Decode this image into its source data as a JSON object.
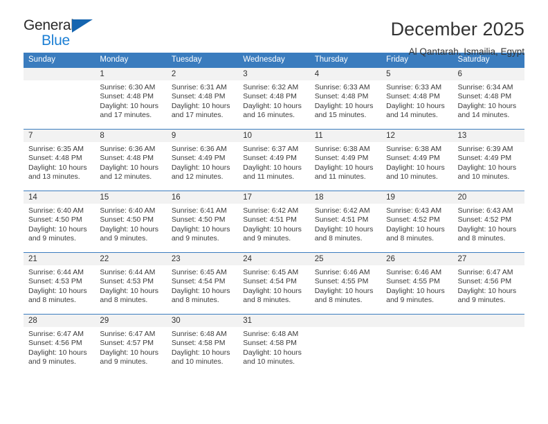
{
  "brand": {
    "name_primary": "General",
    "name_secondary": "Blue",
    "triangle_icon": "triangle-icon"
  },
  "header": {
    "title": "December 2025",
    "subtitle": "Al Qantarah, Ismailia, Egypt"
  },
  "colors": {
    "header_blue": "#3a7cbe",
    "logo_blue": "#1c7fd4",
    "logo_triangle": "#1565b0",
    "daynum_band": "#f2f2f2",
    "text": "#333333"
  },
  "weekday_headers": [
    "Sunday",
    "Monday",
    "Tuesday",
    "Wednesday",
    "Thursday",
    "Friday",
    "Saturday"
  ],
  "labels": {
    "sunrise_prefix": "Sunrise:",
    "sunset_prefix": "Sunset:",
    "daylight_prefix": "Daylight:"
  },
  "weeks": [
    [
      {
        "day": "",
        "blank": true,
        "sunrise": "",
        "sunset": "",
        "daylight_line1": "",
        "daylight_line2": ""
      },
      {
        "day": "1",
        "blank": false,
        "sunrise": "Sunrise: 6:30 AM",
        "sunset": "Sunset: 4:48 PM",
        "daylight_line1": "Daylight: 10 hours",
        "daylight_line2": "and 17 minutes."
      },
      {
        "day": "2",
        "blank": false,
        "sunrise": "Sunrise: 6:31 AM",
        "sunset": "Sunset: 4:48 PM",
        "daylight_line1": "Daylight: 10 hours",
        "daylight_line2": "and 17 minutes."
      },
      {
        "day": "3",
        "blank": false,
        "sunrise": "Sunrise: 6:32 AM",
        "sunset": "Sunset: 4:48 PM",
        "daylight_line1": "Daylight: 10 hours",
        "daylight_line2": "and 16 minutes."
      },
      {
        "day": "4",
        "blank": false,
        "sunrise": "Sunrise: 6:33 AM",
        "sunset": "Sunset: 4:48 PM",
        "daylight_line1": "Daylight: 10 hours",
        "daylight_line2": "and 15 minutes."
      },
      {
        "day": "5",
        "blank": false,
        "sunrise": "Sunrise: 6:33 AM",
        "sunset": "Sunset: 4:48 PM",
        "daylight_line1": "Daylight: 10 hours",
        "daylight_line2": "and 14 minutes."
      },
      {
        "day": "6",
        "blank": false,
        "sunrise": "Sunrise: 6:34 AM",
        "sunset": "Sunset: 4:48 PM",
        "daylight_line1": "Daylight: 10 hours",
        "daylight_line2": "and 14 minutes."
      }
    ],
    [
      {
        "day": "7",
        "blank": false,
        "sunrise": "Sunrise: 6:35 AM",
        "sunset": "Sunset: 4:48 PM",
        "daylight_line1": "Daylight: 10 hours",
        "daylight_line2": "and 13 minutes."
      },
      {
        "day": "8",
        "blank": false,
        "sunrise": "Sunrise: 6:36 AM",
        "sunset": "Sunset: 4:48 PM",
        "daylight_line1": "Daylight: 10 hours",
        "daylight_line2": "and 12 minutes."
      },
      {
        "day": "9",
        "blank": false,
        "sunrise": "Sunrise: 6:36 AM",
        "sunset": "Sunset: 4:49 PM",
        "daylight_line1": "Daylight: 10 hours",
        "daylight_line2": "and 12 minutes."
      },
      {
        "day": "10",
        "blank": false,
        "sunrise": "Sunrise: 6:37 AM",
        "sunset": "Sunset: 4:49 PM",
        "daylight_line1": "Daylight: 10 hours",
        "daylight_line2": "and 11 minutes."
      },
      {
        "day": "11",
        "blank": false,
        "sunrise": "Sunrise: 6:38 AM",
        "sunset": "Sunset: 4:49 PM",
        "daylight_line1": "Daylight: 10 hours",
        "daylight_line2": "and 11 minutes."
      },
      {
        "day": "12",
        "blank": false,
        "sunrise": "Sunrise: 6:38 AM",
        "sunset": "Sunset: 4:49 PM",
        "daylight_line1": "Daylight: 10 hours",
        "daylight_line2": "and 10 minutes."
      },
      {
        "day": "13",
        "blank": false,
        "sunrise": "Sunrise: 6:39 AM",
        "sunset": "Sunset: 4:49 PM",
        "daylight_line1": "Daylight: 10 hours",
        "daylight_line2": "and 10 minutes."
      }
    ],
    [
      {
        "day": "14",
        "blank": false,
        "sunrise": "Sunrise: 6:40 AM",
        "sunset": "Sunset: 4:50 PM",
        "daylight_line1": "Daylight: 10 hours",
        "daylight_line2": "and 9 minutes."
      },
      {
        "day": "15",
        "blank": false,
        "sunrise": "Sunrise: 6:40 AM",
        "sunset": "Sunset: 4:50 PM",
        "daylight_line1": "Daylight: 10 hours",
        "daylight_line2": "and 9 minutes."
      },
      {
        "day": "16",
        "blank": false,
        "sunrise": "Sunrise: 6:41 AM",
        "sunset": "Sunset: 4:50 PM",
        "daylight_line1": "Daylight: 10 hours",
        "daylight_line2": "and 9 minutes."
      },
      {
        "day": "17",
        "blank": false,
        "sunrise": "Sunrise: 6:42 AM",
        "sunset": "Sunset: 4:51 PM",
        "daylight_line1": "Daylight: 10 hours",
        "daylight_line2": "and 9 minutes."
      },
      {
        "day": "18",
        "blank": false,
        "sunrise": "Sunrise: 6:42 AM",
        "sunset": "Sunset: 4:51 PM",
        "daylight_line1": "Daylight: 10 hours",
        "daylight_line2": "and 8 minutes."
      },
      {
        "day": "19",
        "blank": false,
        "sunrise": "Sunrise: 6:43 AM",
        "sunset": "Sunset: 4:52 PM",
        "daylight_line1": "Daylight: 10 hours",
        "daylight_line2": "and 8 minutes."
      },
      {
        "day": "20",
        "blank": false,
        "sunrise": "Sunrise: 6:43 AM",
        "sunset": "Sunset: 4:52 PM",
        "daylight_line1": "Daylight: 10 hours",
        "daylight_line2": "and 8 minutes."
      }
    ],
    [
      {
        "day": "21",
        "blank": false,
        "sunrise": "Sunrise: 6:44 AM",
        "sunset": "Sunset: 4:53 PM",
        "daylight_line1": "Daylight: 10 hours",
        "daylight_line2": "and 8 minutes."
      },
      {
        "day": "22",
        "blank": false,
        "sunrise": "Sunrise: 6:44 AM",
        "sunset": "Sunset: 4:53 PM",
        "daylight_line1": "Daylight: 10 hours",
        "daylight_line2": "and 8 minutes."
      },
      {
        "day": "23",
        "blank": false,
        "sunrise": "Sunrise: 6:45 AM",
        "sunset": "Sunset: 4:54 PM",
        "daylight_line1": "Daylight: 10 hours",
        "daylight_line2": "and 8 minutes."
      },
      {
        "day": "24",
        "blank": false,
        "sunrise": "Sunrise: 6:45 AM",
        "sunset": "Sunset: 4:54 PM",
        "daylight_line1": "Daylight: 10 hours",
        "daylight_line2": "and 8 minutes."
      },
      {
        "day": "25",
        "blank": false,
        "sunrise": "Sunrise: 6:46 AM",
        "sunset": "Sunset: 4:55 PM",
        "daylight_line1": "Daylight: 10 hours",
        "daylight_line2": "and 8 minutes."
      },
      {
        "day": "26",
        "blank": false,
        "sunrise": "Sunrise: 6:46 AM",
        "sunset": "Sunset: 4:55 PM",
        "daylight_line1": "Daylight: 10 hours",
        "daylight_line2": "and 9 minutes."
      },
      {
        "day": "27",
        "blank": false,
        "sunrise": "Sunrise: 6:47 AM",
        "sunset": "Sunset: 4:56 PM",
        "daylight_line1": "Daylight: 10 hours",
        "daylight_line2": "and 9 minutes."
      }
    ],
    [
      {
        "day": "28",
        "blank": false,
        "sunrise": "Sunrise: 6:47 AM",
        "sunset": "Sunset: 4:56 PM",
        "daylight_line1": "Daylight: 10 hours",
        "daylight_line2": "and 9 minutes."
      },
      {
        "day": "29",
        "blank": false,
        "sunrise": "Sunrise: 6:47 AM",
        "sunset": "Sunset: 4:57 PM",
        "daylight_line1": "Daylight: 10 hours",
        "daylight_line2": "and 9 minutes."
      },
      {
        "day": "30",
        "blank": false,
        "sunrise": "Sunrise: 6:48 AM",
        "sunset": "Sunset: 4:58 PM",
        "daylight_line1": "Daylight: 10 hours",
        "daylight_line2": "and 10 minutes."
      },
      {
        "day": "31",
        "blank": false,
        "sunrise": "Sunrise: 6:48 AM",
        "sunset": "Sunset: 4:58 PM",
        "daylight_line1": "Daylight: 10 hours",
        "daylight_line2": "and 10 minutes."
      },
      {
        "day": "",
        "blank": true,
        "sunrise": "",
        "sunset": "",
        "daylight_line1": "",
        "daylight_line2": ""
      },
      {
        "day": "",
        "blank": true,
        "sunrise": "",
        "sunset": "",
        "daylight_line1": "",
        "daylight_line2": ""
      },
      {
        "day": "",
        "blank": true,
        "sunrise": "",
        "sunset": "",
        "daylight_line1": "",
        "daylight_line2": ""
      }
    ]
  ]
}
